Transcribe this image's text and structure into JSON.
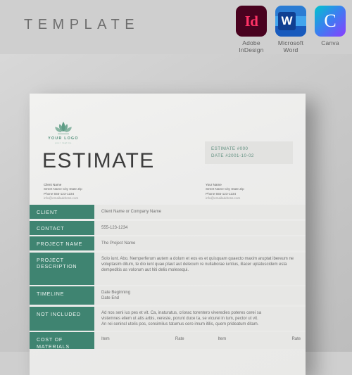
{
  "banner": {
    "title": "TEMPLATE",
    "apps": [
      {
        "id": "adobe-indesign",
        "glyph": "Id",
        "label": "Adobe\nInDesign",
        "label_line1": "Adobe",
        "label_line2": "InDesign",
        "color": "#49021f",
        "accent": "#ff3366"
      },
      {
        "id": "microsoft-word",
        "glyph": "W",
        "label": "Microsoft\nWord",
        "label_line1": "Microsoft",
        "label_line2": "Word",
        "color": "#41a5ee",
        "accent": "#103f91"
      },
      {
        "id": "canva",
        "glyph": "C",
        "label": "Canva",
        "label_line1": "Canva",
        "label_line2": "",
        "color": "#00c4cc",
        "accent": "#8b3dff"
      }
    ]
  },
  "document": {
    "logo": {
      "name": "YOUR LOGO",
      "tagline": "your tagline"
    },
    "title": "ESTIMATE",
    "meta": {
      "estimate_number": "ESTIMATE #000",
      "date": "DATE #2001-10-02"
    },
    "address_left": {
      "line1": "Client Name",
      "line2": "Street Name City State Zip",
      "line3": "Phone 555-123-1234",
      "line4": "info@emailaddress.com"
    },
    "address_right": {
      "line1": "Your Name",
      "line2": "Street Name City State Zip",
      "line3": "Phone 555-123-1234",
      "line4": "info@emailaddress.com"
    },
    "rows": {
      "client": {
        "label": "CLIENT",
        "value": "Client Name or Company Name"
      },
      "contact": {
        "label": "CONTACT",
        "value": "555-123-1234"
      },
      "project_name": {
        "label": "PROJECT NAME",
        "value": "The Project Name"
      },
      "project_description": {
        "label_line1": "PROJECT",
        "label_line2": "DESCRIPTION",
        "value": "Solo iunt. Abo. Nemperferum autem a dolum et eos es et quisquam quaecto maxim aruptat ibereum ne voluptasim ditum, te dio iunt quae plaut aut delecum re nullaborae iuntius, illacer uptatuscidem esta dempeditis as volorum aut hiti delis molesequi."
      },
      "timeline": {
        "label": "TIMELINE",
        "value_line1": "Date Beginning",
        "value_line2": "Date End"
      },
      "not_included": {
        "label": "NOT INCLUDED",
        "value_line1": "Ad nos seni ius pes et vit. Ca, inaturatus, criorac torentero viveredies poteres cerei sa",
        "value_line2": "vistemnes eliem ut atis arbis, vereste, porunt duce ta, se vicurei in tum, pector ut vit.",
        "value_line3": "An rei senincl utelis pos, consimilus tatumus cero imum itilis, quem prideatum ditam."
      },
      "cost_of_materials": {
        "label_line1": "COST OF",
        "label_line2": "MATERIALS",
        "col1": "Item",
        "col2": "Rate",
        "col3": "Item",
        "col4": "Rate"
      }
    }
  },
  "colors": {
    "brand_green": "#3f8471",
    "paper": "#efefed",
    "stage": "#c9c9c9",
    "banner": "#cfcfcf"
  }
}
